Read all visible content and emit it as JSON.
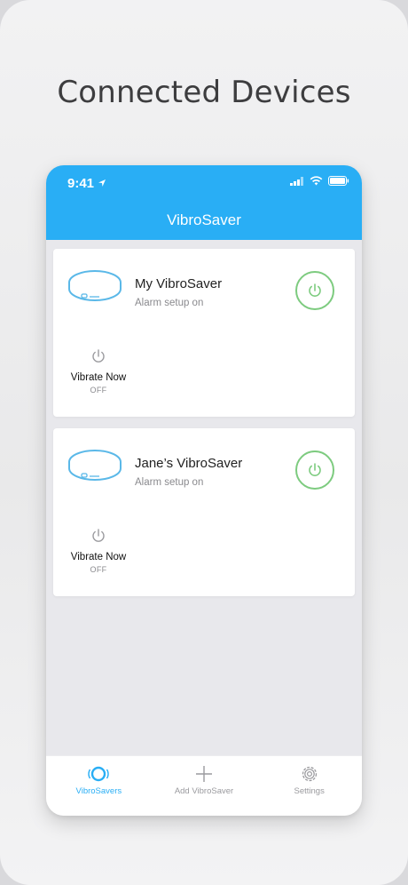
{
  "marketing": {
    "headline": "Connected Devices"
  },
  "status_bar": {
    "time": "9:41"
  },
  "app": {
    "title": "VibroSaver"
  },
  "devices": [
    {
      "name": "My VibroSaver",
      "status": "Alarm setup on",
      "power_icon": "power-icon",
      "vibrate_label": "Vibrate Now",
      "vibrate_state": "OFF"
    },
    {
      "name": "Jane’s VibroSaver",
      "status": "Alarm setup on",
      "power_icon": "power-icon",
      "vibrate_label": "Vibrate Now",
      "vibrate_state": "OFF"
    }
  ],
  "tabs": [
    {
      "label": "VibroSavers",
      "icon": "vibrosaver-icon",
      "active": true
    },
    {
      "label": "Add VibroSaver",
      "icon": "plus-icon",
      "active": false
    },
    {
      "label": "Settings",
      "icon": "gear-icon",
      "active": false
    }
  ],
  "colors": {
    "accent": "#29aef5",
    "power_green": "#7dcb7f",
    "device_outline": "#5ab8e8"
  }
}
